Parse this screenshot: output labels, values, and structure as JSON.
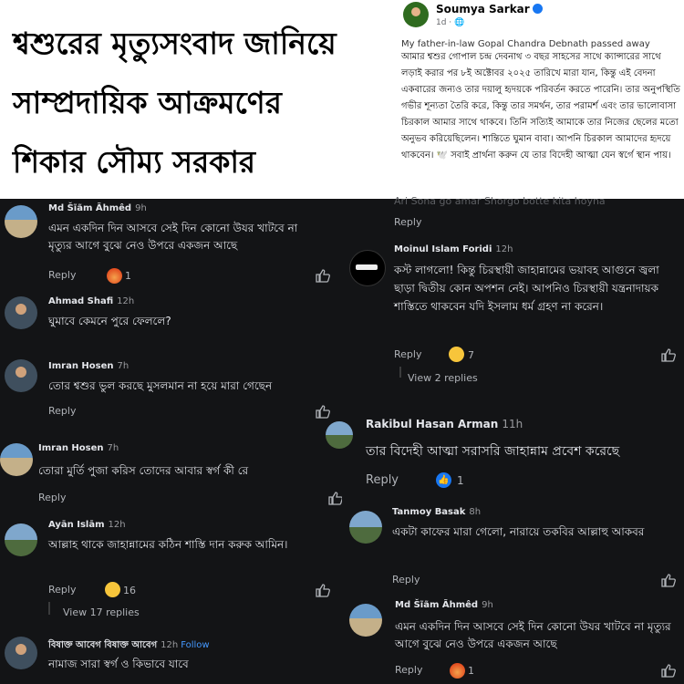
{
  "headline": {
    "line1": "শ্বশুরের মৃত্যুসংবাদ জানিয়ে",
    "line2": "সাম্প্রদায়িক আক্রমণের",
    "line3": "শিকার সৌম্য সরকার"
  },
  "post": {
    "author": "Soumya Sarkar",
    "meta": "1d · 🌐",
    "english_preview": "My father-in-law Gopal Chandra Debnath passed away",
    "text": "আমার শ্বশুর গোপাল চন্দ্র দেবনাথ ৩ বছর সাহসের সাথে ক্যান্সারের সাথে লড়াই করার পর ৮ই অক্টোবর ২০২৫ তারিখে মারা যান, কিন্তু এই বেদনা একবারের জন্যও তার দয়ালু হৃদয়কে পরিবর্তন করতে পারেনি। তার অনুপস্থিতি গভীর শূন্যতা তৈরি করে, কিন্তু তার সমর্থন, তার পরামর্শ এবং তার ভালোবাসা চিরকাল আমার সাথে থাকবে। তিনি সত্যিই আমাকে তার নিজের ছেলের মতো অনুভব করিয়েছিলেন। শান্তিতে ঘুমান বাবা। আপনি চিরকাল আমাদের হৃদয়ে থাকবেন। 🕊️ সবাই প্রার্থনা করুন যে তার বিদেহী আত্মা যেন স্বর্গে স্থান পায়।"
  },
  "left_comments": [
    {
      "name": "Md Šĩãm Ãhmêd",
      "time": "9h",
      "text": "এমন একদিন দিন আসবে সেই দিন কোনো উযর খাটবে না   মৃত্যুর আগে বুঝে নেও উপরে একজন আছে",
      "reply": "Reply",
      "count": "1"
    },
    {
      "name": "Ahmad Shafi",
      "time": "12h",
      "text": "ঘুমাবে কেমনে পুরে ফেললে?",
      "reply": "Reply"
    },
    {
      "name": "Imran Hosen",
      "time": "7h",
      "text": "তোর শ্বশুর ভুল করছে মুসলমান না হয়ে মারা গেছেন",
      "reply": "Reply"
    },
    {
      "name": "Imran Hosen",
      "time": "7h",
      "text": "তোরা মুর্তি পুজা করিস তোদের আবার স্বর্গ কী রে",
      "reply": "Reply"
    },
    {
      "name": "Ayān Islām",
      "time": "12h",
      "text": "আল্লাহ থাকে জাহান্নামের কঠিন শাস্তি দান করুক আমিন।",
      "reply": "Reply",
      "count": "16",
      "view_replies": "View 17 replies"
    },
    {
      "name": "বিষাক্ত আবেগ বিষাক্ত আবেগ",
      "time": "12h",
      "follow": "Follow",
      "text": "নামাজ সারা স্বর্গ ও কিভাবে যাবে"
    }
  ],
  "right_comments": [
    {
      "faint": "Ari Sona go amar Shorgo botte kita hoyna",
      "reply": "Reply"
    },
    {
      "name": "Moinul Islam Foridi",
      "time": "12h",
      "text": "কস্ট লাগলো! কিন্তু চিরস্থায়ী জাহান্নামের ভয়াবহ আগুনে জ্বলা ছাড়া দ্বিতীয় কোন অপশন নেই। আপনিও চিরস্থায়ী যন্ত্রনাদায়ক শাস্তিতে থাকবেন যদি ইসলাম ধর্ম গ্রহণ না করেন।",
      "reply": "Reply",
      "count": "7",
      "view_replies": "View 2 replies"
    },
    {
      "name": "Rakibul Hasan Arman",
      "time": "11h",
      "text": "তার বিদেহী আত্মা সরাসরি জাহান্নাম প্রবেশ করেছে",
      "reply": "Reply",
      "count": "1"
    },
    {
      "name": "Tanmoy Basak",
      "time": "8h",
      "text": "একটা কাফের মারা গেলো, নারায়ে তকবির আল্লাহু আকবর",
      "reply": "Reply"
    },
    {
      "name": "Md Šĩãm Ãhmêd",
      "time": "9h",
      "text": "এমন একদিন দিন আসবে সেই দিন কোনো উযর খাটবে না   মৃত্যুর আগে বুঝে নেও উপরে একজন আছে",
      "reply": "Reply",
      "count": "1"
    }
  ],
  "icons": {
    "thumb": "like-outline-icon",
    "angry": "angry-reaction-icon",
    "laugh": "haha-reaction-icon",
    "like": "like-reaction-icon"
  },
  "colors": {
    "dark_bg": "#131416",
    "accent": "#1877f2"
  }
}
